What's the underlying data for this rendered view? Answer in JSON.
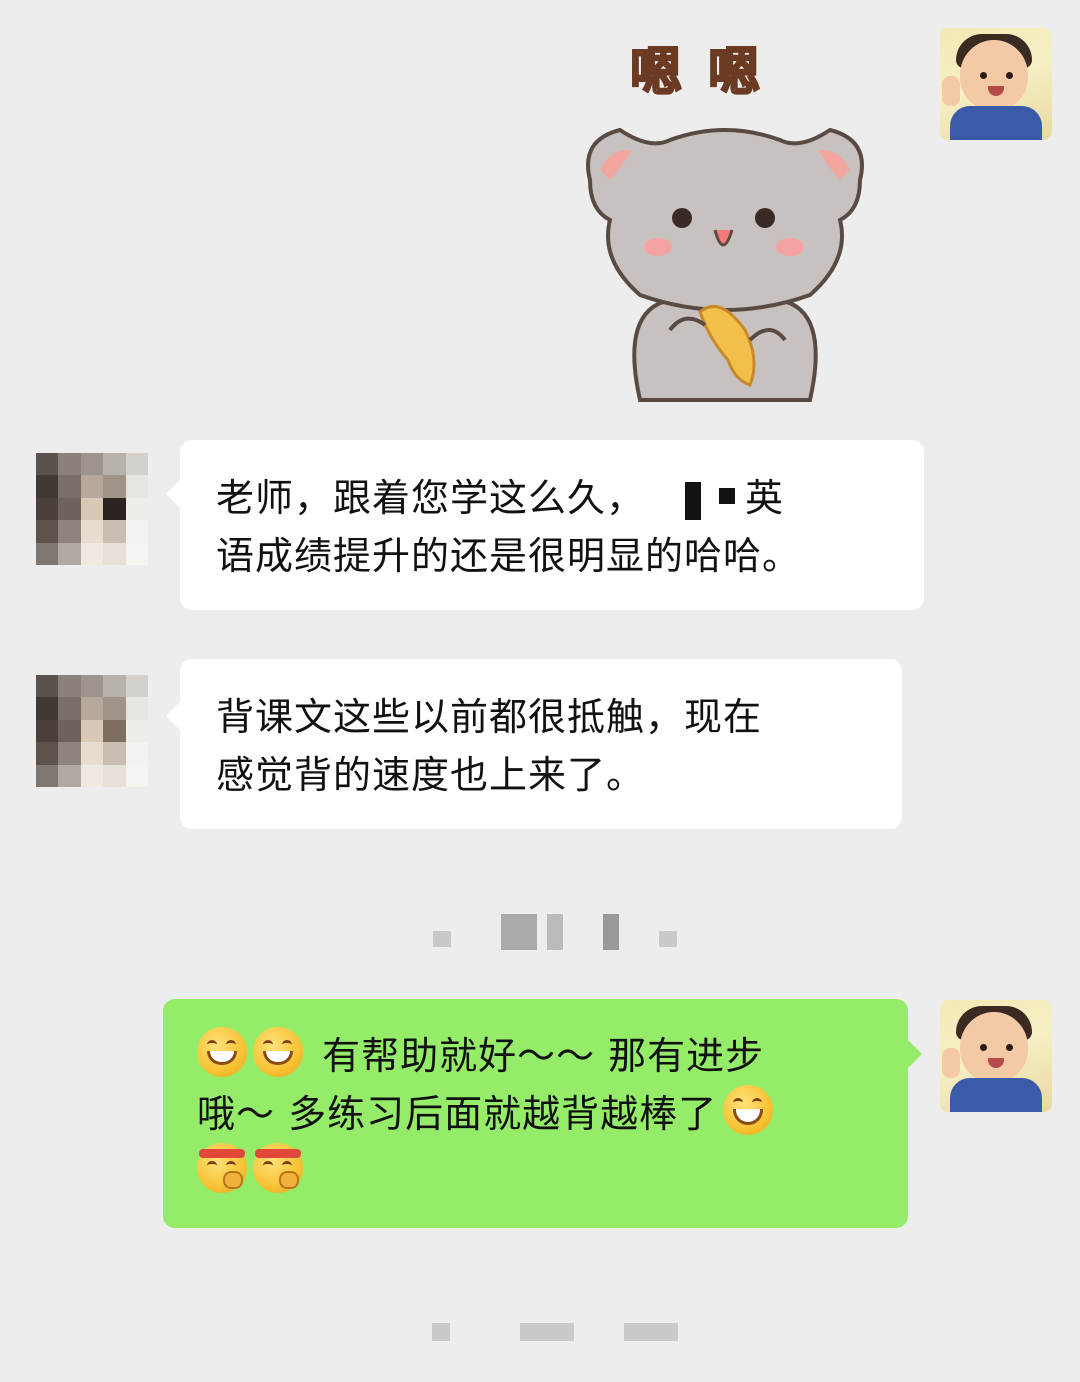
{
  "sticker": {
    "text": "嗯 嗯",
    "name": "cat-sticker"
  },
  "messages": [
    {
      "id": "msg1",
      "direction": "incoming",
      "line1_before": "老师，跟着您学这么久，",
      "line1_after": "英",
      "line2": "语成绩提升的还是很明显的哈哈。"
    },
    {
      "id": "msg2",
      "direction": "incoming",
      "line1": "背课文这些以前都很抵触，现在",
      "line2": "感觉背的速度也上来了。"
    },
    {
      "id": "msg3",
      "direction": "outgoing",
      "line1_text": "有帮助就好～～ 那有进步",
      "line2_text": "哦～ 多练习后面就越背越棒了",
      "emojis": [
        "grin-icon",
        "grin-icon",
        "grin-icon",
        "fist-headband-icon",
        "fist-headband-icon"
      ]
    }
  ],
  "colors": {
    "background": "#ededed",
    "incoming_bubble": "#ffffff",
    "outgoing_bubble": "#95ec69"
  }
}
